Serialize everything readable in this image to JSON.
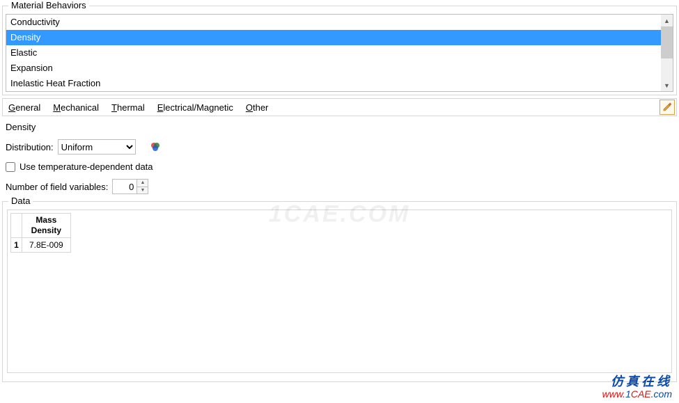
{
  "behaviors": {
    "legend": "Material Behaviors",
    "items": [
      "Conductivity",
      "Density",
      "Elastic",
      "Expansion",
      "Inelastic Heat Fraction"
    ],
    "selected_index": 1
  },
  "menubar": {
    "items": [
      {
        "u": "G",
        "rest": "eneral"
      },
      {
        "u": "M",
        "rest": "echanical"
      },
      {
        "u": "T",
        "rest": "hermal"
      },
      {
        "u": "E",
        "rest": "lectrical/Magnetic"
      },
      {
        "u": "O",
        "rest": "ther"
      }
    ]
  },
  "section": {
    "title": "Density",
    "distribution_label": "Distribution:",
    "distribution_value": "Uniform",
    "use_temp_label": "Use temperature-dependent data",
    "use_temp_checked": false,
    "nfv_label": "Number of field variables:",
    "nfv_value": "0"
  },
  "data": {
    "legend": "Data",
    "columns": [
      "Mass\nDensity"
    ],
    "rows": [
      {
        "index": "1",
        "values": [
          "7.8E-009"
        ]
      }
    ]
  },
  "watermark": "1CAE.COM",
  "footer": {
    "cn": "仿真在线",
    "url_www": "www.",
    "url_1": "1",
    "url_cae": "CAE",
    "url_com": ".com"
  }
}
